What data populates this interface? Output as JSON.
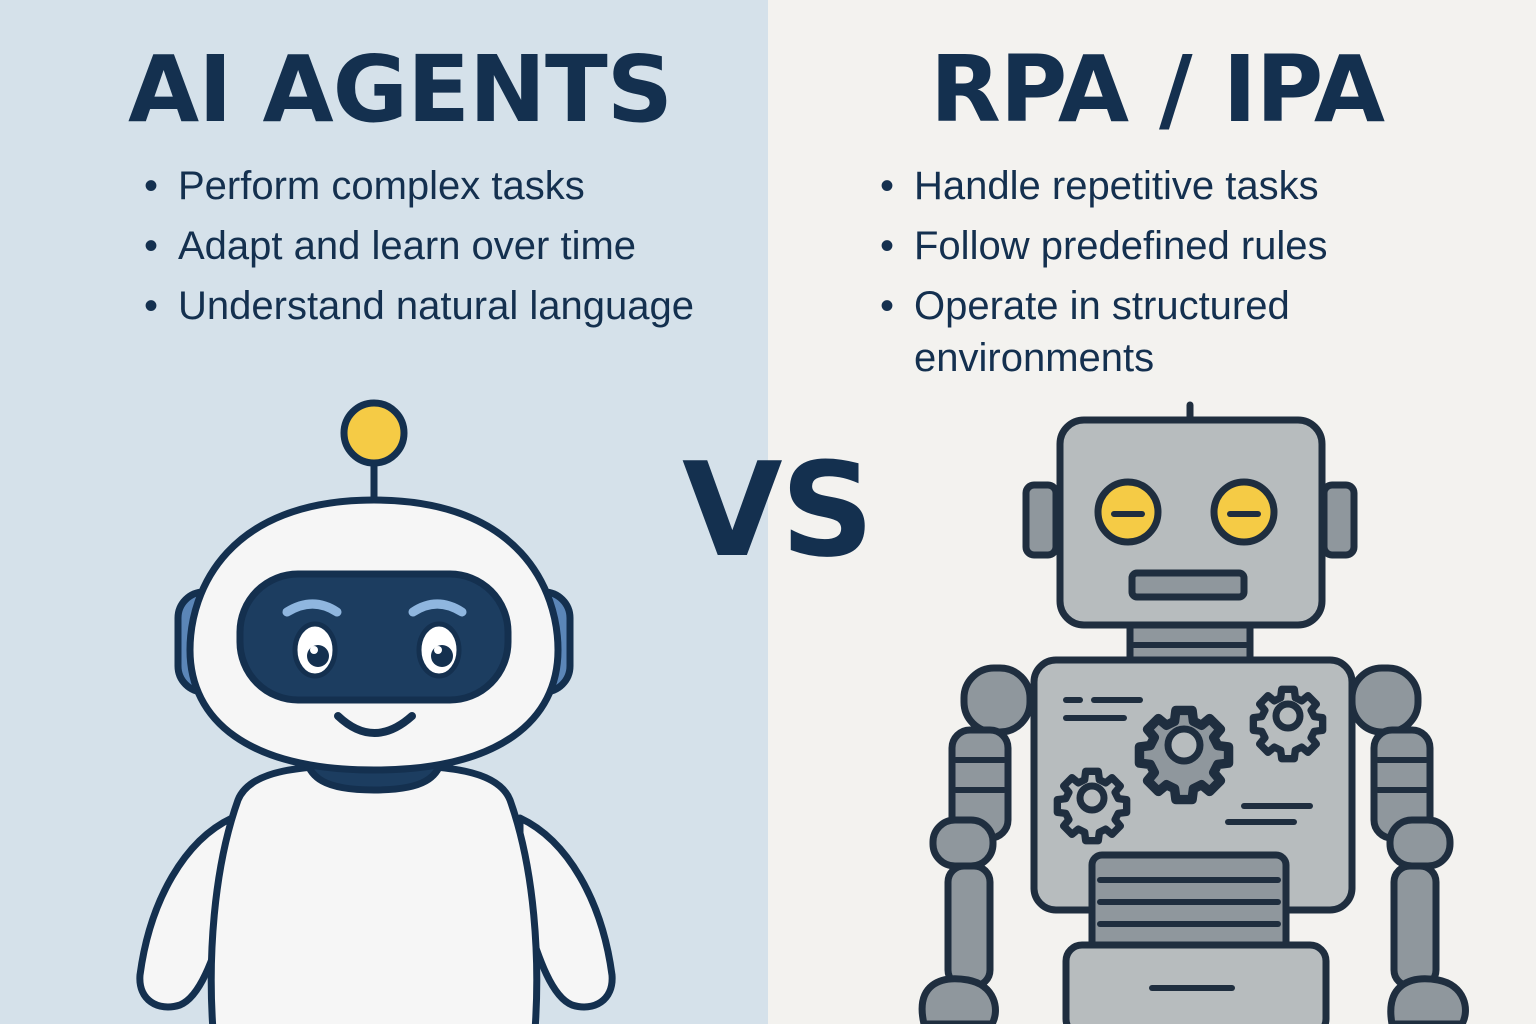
{
  "left": {
    "title": "AI AGENTS",
    "bullets": [
      "Perform complex tasks",
      "Adapt and learn over time",
      "Understand natural language"
    ]
  },
  "right": {
    "title": "RPA / IPA",
    "bullets": [
      "Handle repetitive tasks",
      "Follow predefined rules",
      "Operate in structured environments"
    ]
  },
  "vs": "VS",
  "colors": {
    "navy": "#14304f",
    "left_background": "#d5e1ea",
    "right_background": "#f3f2ef",
    "accent_yellow": "#f5cb45",
    "robot_gray": "#b7bcbe",
    "ear_blue": "#5b86b8"
  },
  "icons": [
    "ai-agent-robot-icon",
    "rpa-robot-icon",
    "gear-icon"
  ]
}
